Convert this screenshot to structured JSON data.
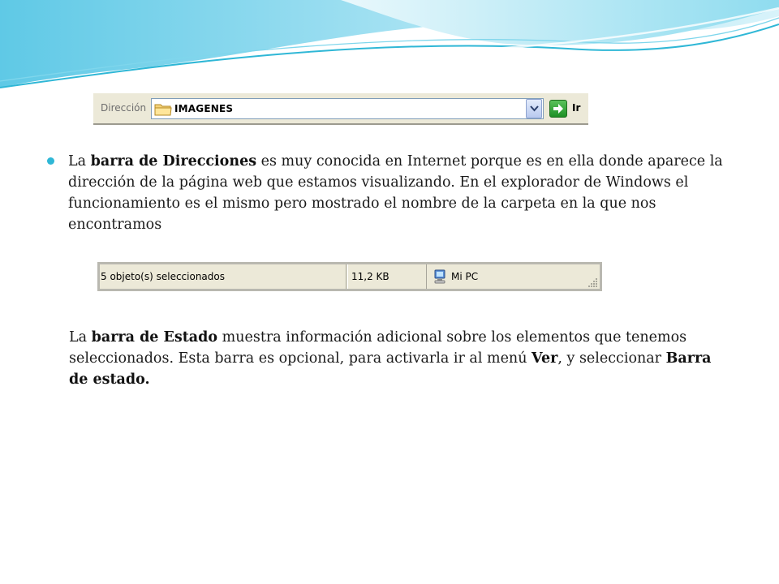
{
  "address_bar": {
    "label": "Dirección",
    "value": "IMAGENES",
    "go_label": "Ir"
  },
  "paragraph_1": {
    "t1": "La ",
    "b1": "barra de Direcciones",
    "t2": " es muy conocida en Internet porque es en ella donde aparece la dirección de la página web que estamos visualizando.  En el explorador de Windows el funcionamiento es el mismo pero mostrado el nombre de la carpeta en la que nos encontramos"
  },
  "status_bar": {
    "selection": "5 objeto(s) seleccionados",
    "size": "11,2 KB",
    "location": "Mi PC"
  },
  "paragraph_2": {
    "t1": "La ",
    "b1": "barra de Estado",
    "t2": " muestra información adicional sobre los elementos que tenemos seleccionados. Esta barra es opcional, para activarla ir al menú ",
    "b2": "Ver",
    "t3": ", y seleccionar ",
    "b3": "Barra de estado."
  },
  "icons": [
    "folder-icon",
    "dropdown-arrow-icon",
    "go-arrow-icon",
    "computer-icon",
    "resize-grip-icon"
  ],
  "colors": {
    "wave_light": "#bfeaf5",
    "wave_mid": "#6fd0ea",
    "wave_dark": "#2fb7d6",
    "bullet": "#2fb7d6"
  }
}
